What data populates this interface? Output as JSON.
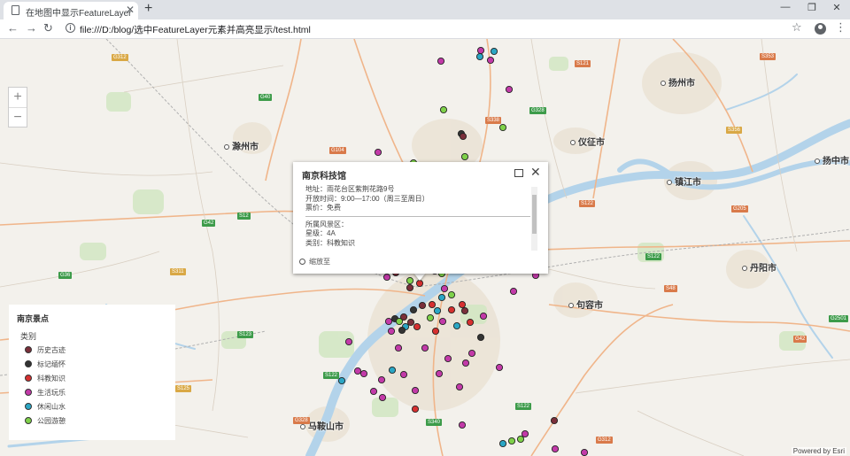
{
  "browser": {
    "tab_title": "在地图中显示FeatureLayer",
    "url": "file:///D:/blog/选中FeatureLayer元素并高亮显示/test.html"
  },
  "map": {
    "cities": [
      {
        "name": "扬州市"
      },
      {
        "name": "滁州市"
      },
      {
        "name": "仪征市"
      },
      {
        "name": "镇江市"
      },
      {
        "name": "扬中市"
      },
      {
        "name": "丹阳市"
      },
      {
        "name": "句容市"
      },
      {
        "name": "马鞍山市"
      }
    ],
    "shields": [
      "G312",
      "S121",
      "S353",
      "G40",
      "G104",
      "S338",
      "G328",
      "S356",
      "S12",
      "G42",
      "S122",
      "G205",
      "S122",
      "S311",
      "G36",
      "S48",
      "G2501",
      "S123",
      "G42",
      "S122",
      "S125",
      "S122",
      "G328",
      "S340",
      "G312"
    ],
    "attribution": "Powered by Esri"
  },
  "colors": {
    "历史古迹": "#7a2f3a",
    "标记缅怀": "#333333",
    "科教知识": "#d63030",
    "生活玩乐": "#c23aa8",
    "休闲山水": "#2ba6c4",
    "公园游憩": "#7fd14a"
  },
  "popup": {
    "title": "南京科技馆",
    "rows": [
      "地址：雨花台区紫荆花路9号",
      "开放时间：9:00—17:00（周三至周日）",
      "票价：免费"
    ],
    "rows2": [
      "所属风景区：",
      "星级：4A",
      "类别：科教知识"
    ],
    "zoom_label": "缩放至"
  },
  "legend": {
    "title": "南京景点",
    "subtitle": "类别",
    "items": [
      {
        "label": "历史古迹",
        "color": "#7a2f3a"
      },
      {
        "label": "标记缅怀",
        "color": "#333333"
      },
      {
        "label": "科教知识",
        "color": "#d63030"
      },
      {
        "label": "生活玩乐",
        "color": "#c23aa8"
      },
      {
        "label": "休闲山水",
        "color": "#2ba6c4"
      },
      {
        "label": "公园游憩",
        "color": "#7fd14a"
      }
    ]
  }
}
